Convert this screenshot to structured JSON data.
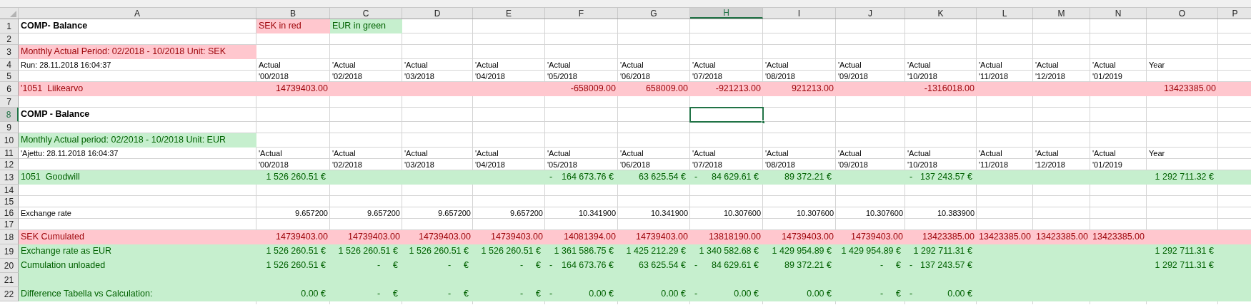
{
  "columns": [
    {
      "label": "A",
      "selected": false
    },
    {
      "label": "B",
      "selected": false
    },
    {
      "label": "C",
      "selected": false
    },
    {
      "label": "D",
      "selected": false
    },
    {
      "label": "E",
      "selected": false
    },
    {
      "label": "F",
      "selected": false
    },
    {
      "label": "G",
      "selected": false
    },
    {
      "label": "H",
      "selected": true
    },
    {
      "label": "I",
      "selected": false
    },
    {
      "label": "J",
      "selected": false
    },
    {
      "label": "K",
      "selected": false
    },
    {
      "label": "L",
      "selected": false
    },
    {
      "label": "M",
      "selected": false
    },
    {
      "label": "N",
      "selected": false
    },
    {
      "label": "O",
      "selected": false
    },
    {
      "label": "P",
      "selected": false
    }
  ],
  "rows": [
    {
      "number": "1",
      "selected": false,
      "cells": [
        {
          "kind": "label",
          "text": "COMP- Balance",
          "bold": true
        },
        {
          "kind": "label",
          "text": "SEK in red",
          "color": "#ffc7ce"
        },
        {
          "kind": "label",
          "text": "EUR in green",
          "color": "#c6efce"
        }
      ]
    },
    {
      "number": "2",
      "selected": false,
      "cells": []
    },
    {
      "number": "3",
      "selected": false,
      "cells": [
        {
          "kind": "label",
          "text": "Monthly Actual Period: 02/2018 - 10/2018 Unit: SEK",
          "color": "#ffc7ce"
        }
      ]
    },
    {
      "number": "4",
      "selected": false,
      "cells": [
        {
          "kind": "label",
          "text": "Run: 28.11.2018 16:04:37"
        },
        {
          "kind": "label",
          "text": "Actual"
        },
        {
          "kind": "label",
          "text": "'Actual"
        },
        {
          "kind": "label",
          "text": "'Actual"
        },
        {
          "kind": "label",
          "text": "'Actual"
        },
        {
          "kind": "label",
          "text": "'Actual"
        },
        {
          "kind": "label",
          "text": "'Actual"
        },
        {
          "kind": "label",
          "text": "'Actual"
        },
        {
          "kind": "label",
          "text": "'Actual"
        },
        {
          "kind": "label",
          "text": "'Actual"
        },
        {
          "kind": "label",
          "text": "'Actual"
        },
        {
          "kind": "label",
          "text": "'Actual"
        },
        {
          "kind": "label",
          "text": "'Actual"
        },
        {
          "kind": "label",
          "text": "'Actual"
        },
        {
          "kind": "label",
          "text": "Year"
        }
      ]
    },
    {
      "number": "5",
      "selected": false,
      "cells": [
        null,
        {
          "kind": "label",
          "text": "'00/2018"
        },
        {
          "kind": "label",
          "text": "'02/2018"
        },
        {
          "kind": "label",
          "text": "'03/2018"
        },
        {
          "kind": "label",
          "text": "'04/2018"
        },
        {
          "kind": "label",
          "text": "'05/2018"
        },
        {
          "kind": "label",
          "text": "'06/2018"
        },
        {
          "kind": "label",
          "text": "'07/2018"
        },
        {
          "kind": "label",
          "text": "'08/2018"
        },
        {
          "kind": "label",
          "text": "'09/2018"
        },
        {
          "kind": "label",
          "text": "'10/2018"
        },
        {
          "kind": "label",
          "text": "'11/2018"
        },
        {
          "kind": "label",
          "text": "'12/2018"
        },
        {
          "kind": "label",
          "text": "'01/2019"
        }
      ]
    },
    {
      "number": "6",
      "selected": false,
      "color": "#ffc7ce",
      "cells": [
        {
          "kind": "label",
          "text": "'1051  Liikearvo"
        },
        {
          "kind": "number",
          "text": "14739403.00"
        },
        null,
        null,
        null,
        {
          "kind": "number",
          "text": "-658009.00"
        },
        {
          "kind": "number",
          "text": "658009.00"
        },
        {
          "kind": "number",
          "text": "-921213.00"
        },
        {
          "kind": "number",
          "text": "921213.00"
        },
        null,
        {
          "kind": "number",
          "text": "-1316018.00"
        },
        null,
        null,
        null,
        {
          "kind": "number",
          "text": "13423385.00"
        }
      ]
    },
    {
      "number": "7",
      "selected": false,
      "cells": []
    },
    {
      "number": "8",
      "selected": true,
      "cells": [
        {
          "kind": "label",
          "text": "COMP - Balance",
          "bold": true
        }
      ]
    },
    {
      "number": "9",
      "selected": false,
      "cells": []
    },
    {
      "number": "10",
      "selected": false,
      "cells": [
        {
          "kind": "label",
          "text": "Monthly Actual period: 02/2018 - 10/2018 Unit: EUR",
          "color": "#c6efce"
        }
      ]
    },
    {
      "number": "11",
      "selected": false,
      "cells": [
        {
          "kind": "label",
          "text": "'Ajettu: 28.11.2018 16:04:37"
        },
        {
          "kind": "label",
          "text": "'Actual"
        },
        {
          "kind": "label",
          "text": "'Actual"
        },
        {
          "kind": "label",
          "text": "'Actual"
        },
        {
          "kind": "label",
          "text": "'Actual"
        },
        {
          "kind": "label",
          "text": "'Actual"
        },
        {
          "kind": "label",
          "text": "'Actual"
        },
        {
          "kind": "label",
          "text": "'Actual"
        },
        {
          "kind": "label",
          "text": "'Actual"
        },
        {
          "kind": "label",
          "text": "'Actual"
        },
        {
          "kind": "label",
          "text": "'Actual"
        },
        {
          "kind": "label",
          "text": "'Actual"
        },
        {
          "kind": "label",
          "text": "'Actual"
        },
        {
          "kind": "label",
          "text": "'Actual"
        },
        {
          "kind": "label",
          "text": "Year"
        }
      ]
    },
    {
      "number": "12",
      "selected": false,
      "cells": [
        null,
        {
          "kind": "label",
          "text": "'00/2018"
        },
        {
          "kind": "label",
          "text": "'02/2018"
        },
        {
          "kind": "label",
          "text": "'03/2018"
        },
        {
          "kind": "label",
          "text": "'04/2018"
        },
        {
          "kind": "label",
          "text": "'05/2018"
        },
        {
          "kind": "label",
          "text": "'06/2018"
        },
        {
          "kind": "label",
          "text": "'07/2018"
        },
        {
          "kind": "label",
          "text": "'08/2018"
        },
        {
          "kind": "label",
          "text": "'09/2018"
        },
        {
          "kind": "label",
          "text": "'10/2018"
        },
        {
          "kind": "label",
          "text": "'11/2018"
        },
        {
          "kind": "label",
          "text": "'12/2018"
        },
        {
          "kind": "label",
          "text": "'01/2019"
        }
      ]
    },
    {
      "number": "13",
      "selected": false,
      "color": "#c6efce",
      "cells": [
        {
          "kind": "label",
          "text": "1051  Goodwill"
        },
        {
          "kind": "amount",
          "text": "1 526 260.51 €"
        },
        null,
        null,
        null,
        {
          "kind": "amount",
          "sign": "-",
          "text": "164 673.76 €"
        },
        {
          "kind": "amount",
          "text": "63 625.54 €"
        },
        {
          "kind": "amount",
          "sign": "-",
          "text": "84 629.61 €"
        },
        {
          "kind": "amount",
          "text": "89 372.21 €"
        },
        null,
        {
          "kind": "amount",
          "sign": "-",
          "text": "137 243.57 €"
        },
        null,
        null,
        null,
        {
          "kind": "amount",
          "text": "1 292 711.32 €"
        }
      ]
    },
    {
      "number": "14",
      "selected": false,
      "cells": []
    },
    {
      "number": "15",
      "selected": false,
      "cells": []
    },
    {
      "number": "16",
      "selected": false,
      "cells": [
        {
          "kind": "label",
          "text": "Exchange rate"
        },
        {
          "kind": "number",
          "text": "9.657200"
        },
        {
          "kind": "number",
          "text": "9.657200"
        },
        {
          "kind": "number",
          "text": "9.657200"
        },
        {
          "kind": "number",
          "text": "9.657200"
        },
        {
          "kind": "number",
          "text": "10.341900"
        },
        {
          "kind": "number",
          "text": "10.341900"
        },
        {
          "kind": "number",
          "text": "10.307600"
        },
        {
          "kind": "number",
          "text": "10.307600"
        },
        {
          "kind": "number",
          "text": "10.307600"
        },
        {
          "kind": "number",
          "text": "10.383900"
        }
      ]
    },
    {
      "number": "17",
      "selected": false,
      "cells": []
    },
    {
      "number": "18",
      "selected": false,
      "color": "#ffc7ce",
      "cells": [
        {
          "kind": "label",
          "text": "SEK Cumulated"
        },
        {
          "kind": "number",
          "text": "14739403.00"
        },
        {
          "kind": "number",
          "text": "14739403.00"
        },
        {
          "kind": "number",
          "text": "14739403.00"
        },
        {
          "kind": "number",
          "text": "14739403.00"
        },
        {
          "kind": "number",
          "text": "14081394.00"
        },
        {
          "kind": "number",
          "text": "14739403.00"
        },
        {
          "kind": "number",
          "text": "13818190.00"
        },
        {
          "kind": "number",
          "text": "14739403.00"
        },
        {
          "kind": "number",
          "text": "14739403.00"
        },
        {
          "kind": "number",
          "text": "13423385.00"
        },
        {
          "kind": "number",
          "text": "13423385.00"
        },
        {
          "kind": "number",
          "text": "13423385.00"
        },
        {
          "kind": "number",
          "text": "13423385.00"
        }
      ]
    },
    {
      "number": "19",
      "selected": false,
      "color": "#c6efce",
      "cells": [
        {
          "kind": "label",
          "text": "Exchange rate as EUR"
        },
        {
          "kind": "amount",
          "text": "1 526 260.51 €"
        },
        {
          "kind": "amount",
          "text": "1 526 260.51 €"
        },
        {
          "kind": "amount",
          "text": "1 526 260.51 €"
        },
        {
          "kind": "amount",
          "text": "1 526 260.51 €"
        },
        {
          "kind": "amount",
          "text": "1 361 586.75 €"
        },
        {
          "kind": "amount",
          "text": "1 425 212.29 €"
        },
        {
          "kind": "amount",
          "text": "1 340 582.68 €"
        },
        {
          "kind": "amount",
          "text": "1 429 954.89 €"
        },
        {
          "kind": "amount",
          "text": "1 429 954.89 €"
        },
        {
          "kind": "amount",
          "text": "1 292 711.31 €"
        },
        null,
        null,
        null,
        {
          "kind": "amount",
          "text": "1 292 711.31 €"
        }
      ]
    },
    {
      "number": "20",
      "selected": false,
      "color": "#c6efce",
      "cells": [
        {
          "kind": "label",
          "text": "Cumulation unloaded"
        },
        {
          "kind": "amount",
          "text": "1 526 260.51 €"
        },
        {
          "kind": "zero",
          "sign": "-",
          "text": "€"
        },
        {
          "kind": "zero",
          "sign": "-",
          "text": "€"
        },
        {
          "kind": "zero",
          "sign": "-",
          "text": "€"
        },
        {
          "kind": "amount",
          "sign": "-",
          "text": "164 673.76 €"
        },
        {
          "kind": "amount",
          "text": "63 625.54 €"
        },
        {
          "kind": "amount",
          "sign": "-",
          "text": "84 629.61 €"
        },
        {
          "kind": "amount",
          "text": "89 372.21 €"
        },
        {
          "kind": "zero",
          "sign": "-",
          "text": "€"
        },
        {
          "kind": "amount",
          "sign": "-",
          "text": "137 243.57 €"
        },
        null,
        null,
        null,
        {
          "kind": "amount",
          "text": "1 292 711.31 €"
        }
      ]
    },
    {
      "number": "21",
      "selected": false,
      "color": "#c6efce",
      "cells": []
    },
    {
      "number": "22",
      "selected": false,
      "color": "#c6efce",
      "cells": [
        {
          "kind": "label",
          "text": "Difference Tabella vs Calculation:"
        },
        {
          "kind": "amount",
          "text": "0.00 €"
        },
        {
          "kind": "zero",
          "sign": "-",
          "text": "€"
        },
        {
          "kind": "zero",
          "sign": "-",
          "text": "€"
        },
        {
          "kind": "zero",
          "sign": "-",
          "text": "€"
        },
        {
          "kind": "amount",
          "sign": "-",
          "text": "0.00 €"
        },
        {
          "kind": "amount",
          "text": "0.00 €"
        },
        {
          "kind": "amount",
          "sign": "-",
          "text": "0.00 €"
        },
        {
          "kind": "amount",
          "text": "0.00 €"
        },
        {
          "kind": "zero",
          "sign": "-",
          "text": "€"
        },
        {
          "kind": "amount",
          "sign": "-",
          "text": "0.00 €"
        }
      ]
    }
  ]
}
